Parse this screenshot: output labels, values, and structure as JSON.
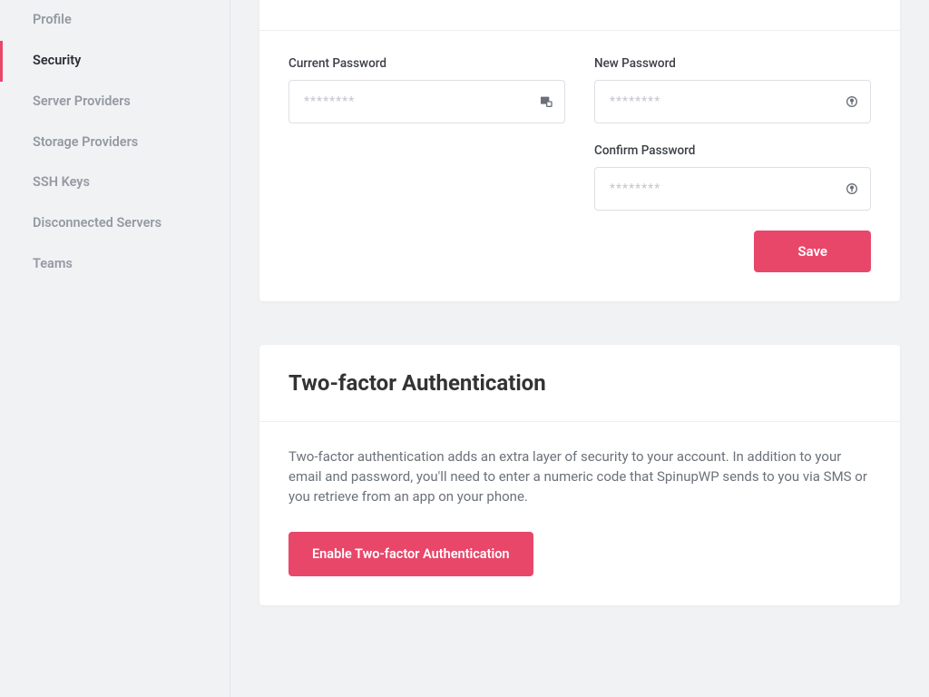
{
  "sidebar": {
    "items": [
      {
        "label": "Profile",
        "active": false
      },
      {
        "label": "Security",
        "active": true
      },
      {
        "label": "Server Providers",
        "active": false
      },
      {
        "label": "Storage Providers",
        "active": false
      },
      {
        "label": "SSH Keys",
        "active": false
      },
      {
        "label": "Disconnected Servers",
        "active": false
      },
      {
        "label": "Teams",
        "active": false
      }
    ]
  },
  "password_card": {
    "current_label": "Current Password",
    "new_label": "New Password",
    "confirm_label": "Confirm Password",
    "placeholder": "********",
    "save_label": "Save"
  },
  "tfa_card": {
    "title": "Two-factor Authentication",
    "body": "Two-factor authentication adds an extra layer of security to your account. In addition to your email and password, you'll need to enter a numeric code that SpinupWP sends to you via SMS or you retrieve from an app on your phone.",
    "button_label": "Enable Two-factor Authentication"
  },
  "colors": {
    "accent": "#e8476a"
  }
}
